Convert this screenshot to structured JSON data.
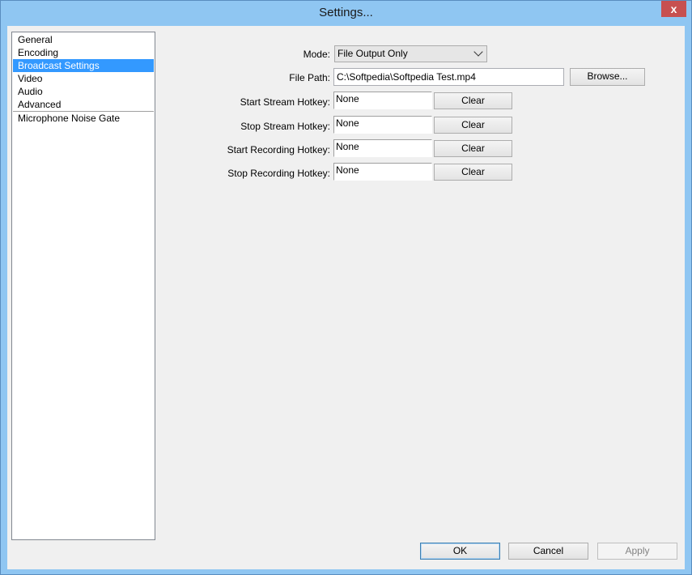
{
  "window": {
    "title": "Settings...",
    "close_glyph": "x"
  },
  "sidebar": {
    "items": [
      {
        "label": "General"
      },
      {
        "label": "Encoding"
      },
      {
        "label": "Broadcast Settings"
      },
      {
        "label": "Video"
      },
      {
        "label": "Audio"
      },
      {
        "label": "Advanced"
      },
      {
        "label": "Microphone Noise Gate"
      }
    ],
    "selected": "Broadcast Settings"
  },
  "form": {
    "mode_label": "Mode:",
    "mode_value": "File Output Only",
    "file_path_label": "File Path:",
    "file_path_value": "C:\\Softpedia\\Softpedia Test.mp4",
    "browse_label": "Browse...",
    "hotkeys": [
      {
        "label": "Start Stream Hotkey:",
        "value": "None",
        "clear": "Clear"
      },
      {
        "label": "Stop Stream Hotkey:",
        "value": "None",
        "clear": "Clear"
      },
      {
        "label": "Start Recording Hotkey:",
        "value": "None",
        "clear": "Clear"
      },
      {
        "label": "Stop Recording Hotkey:",
        "value": "None",
        "clear": "Clear"
      }
    ]
  },
  "footer": {
    "ok_label": "OK",
    "cancel_label": "Cancel",
    "apply_label": "Apply"
  },
  "colors": {
    "frame": "#8fc6f2",
    "selection": "#3399ff",
    "close_button": "#c75050"
  }
}
